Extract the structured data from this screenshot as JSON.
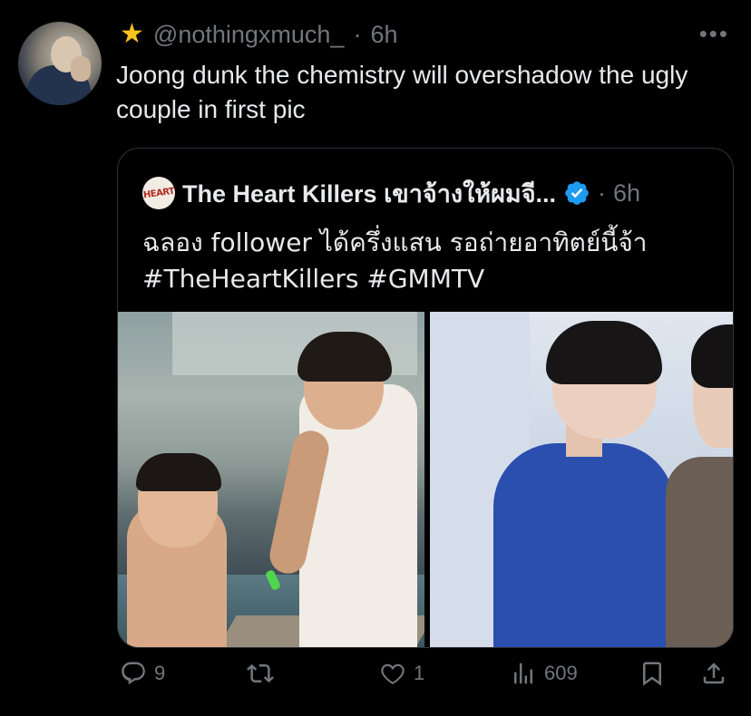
{
  "tweet": {
    "handle": "@nothingxmuch_",
    "separator": "·",
    "time": "6h",
    "text": "Joong dunk the chemistry will overshadow the ugly couple in first pic",
    "badge_icon": "star-icon",
    "more_icon": "more-icon"
  },
  "quoted": {
    "logo_text": "HEART",
    "name": "The Heart Killers เขาจ้างให้ผมจี...",
    "separator": "·",
    "time": "6h",
    "text_line1": "ฉลอง follower ได้ครึ่งแสน รอถ่ายอาทิตย์นี้จ้า",
    "text_line2": "#TheHeartKillers #GMMTV",
    "verified_icon": "verified-icon"
  },
  "actions": {
    "reply_count": "9",
    "repost_count": "",
    "like_count": "1",
    "views_count": "609"
  },
  "colors": {
    "background": "#000000",
    "text": "#e7e9ea",
    "muted": "#71767b",
    "verified": "#1d9bf0",
    "star": "#f7c21b"
  }
}
